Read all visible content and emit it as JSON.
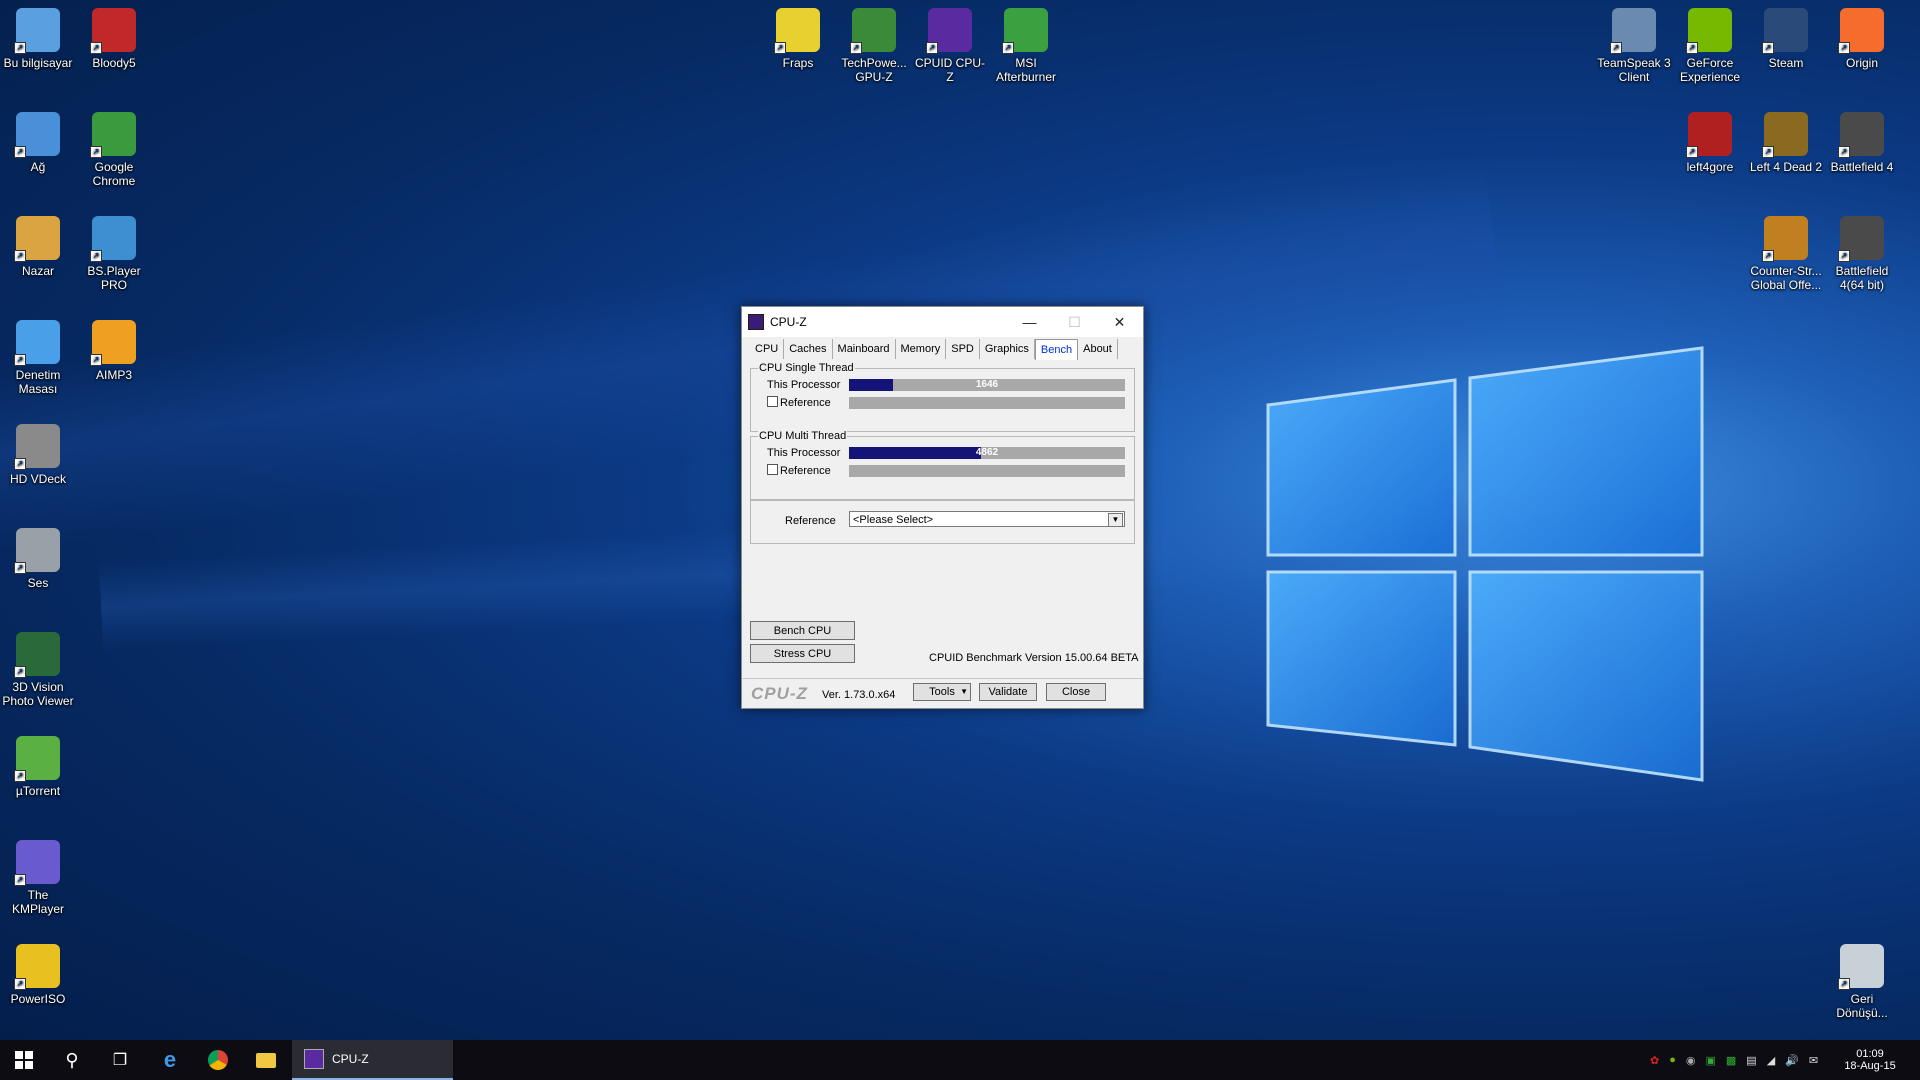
{
  "desktop": {
    "icons": [
      {
        "label": "Bu bilgisayar",
        "icon": "computer-icon",
        "color": "#5aa0e0"
      },
      {
        "label": "Bloody5",
        "icon": "bloody-icon",
        "color": "#c0282a"
      },
      {
        "label": "Ağ",
        "icon": "network-icon",
        "color": "#4a90d9"
      },
      {
        "label": "Google Chrome",
        "icon": "chrome-icon",
        "color": "#3a9a3e"
      },
      {
        "label": "Nazar",
        "icon": "user-folder-icon",
        "color": "#d9a441"
      },
      {
        "label": "BS.Player PRO",
        "icon": "bsplayer-icon",
        "color": "#3d8fd1"
      },
      {
        "label": "Denetim Masası",
        "icon": "control-panel-icon",
        "color": "#4aa0e8"
      },
      {
        "label": "AIMP3",
        "icon": "aimp-icon",
        "color": "#f0a020"
      },
      {
        "label": "HD VDeck",
        "icon": "hdvdeck-icon",
        "color": "#8a8a8a"
      },
      {
        "label": "Ses",
        "icon": "speaker-icon",
        "color": "#9aa0a8"
      },
      {
        "label": "3D Vision Photo Viewer",
        "icon": "3dvision-icon",
        "color": "#2a6a3a"
      },
      {
        "label": "µTorrent",
        "icon": "utorrent-icon",
        "color": "#5ab043"
      },
      {
        "label": "The KMPlayer",
        "icon": "kmplayer-icon",
        "color": "#6a5ad0"
      },
      {
        "label": "PowerISO",
        "icon": "poweriso-icon",
        "color": "#e8c020"
      },
      {
        "label": "Fraps",
        "icon": "fraps-icon",
        "color": "#e8d030"
      },
      {
        "label": "TechPowe... GPU-Z",
        "icon": "gpuz-icon",
        "color": "#3a8a3a"
      },
      {
        "label": "CPUID CPU-Z",
        "icon": "cpuz-icon",
        "color": "#5a2aa0"
      },
      {
        "label": "MSI Afterburner",
        "icon": "afterburner-icon",
        "color": "#3aa040"
      },
      {
        "label": "TeamSpeak 3 Client",
        "icon": "teamspeak-icon",
        "color": "#6a8ab0"
      },
      {
        "label": "GeForce Experience",
        "icon": "geforce-icon",
        "color": "#76b900"
      },
      {
        "label": "Steam",
        "icon": "steam-icon",
        "color": "#2a4a7a"
      },
      {
        "label": "Origin",
        "icon": "origin-icon",
        "color": "#f56c2d"
      },
      {
        "label": "left4gore",
        "icon": "left4gore-icon",
        "color": "#b02020"
      },
      {
        "label": "Left 4 Dead 2",
        "icon": "l4d2-icon",
        "color": "#8a6a20"
      },
      {
        "label": "Battlefield 4",
        "icon": "bf4-icon",
        "color": "#4a4a4a"
      },
      {
        "label": "Counter-Str... Global Offe...",
        "icon": "csgo-icon",
        "color": "#c08020"
      },
      {
        "label": "Battlefield 4(64 bit)",
        "icon": "bf4-64-icon",
        "color": "#4a4a4a"
      },
      {
        "label": "Geri Dönüşü...",
        "icon": "recycle-bin-icon",
        "color": "#c8d0d8"
      }
    ]
  },
  "window": {
    "title": "CPU-Z",
    "tabs": [
      "CPU",
      "Caches",
      "Mainboard",
      "Memory",
      "SPD",
      "Graphics",
      "Bench",
      "About"
    ],
    "active_tab": "Bench",
    "single": {
      "legend": "CPU Single Thread",
      "this_label": "This Processor",
      "this_value": "1646",
      "this_fraction": 0.16,
      "ref_label": "Reference"
    },
    "multi": {
      "legend": "CPU Multi Thread",
      "this_label": "This Processor",
      "this_value": "4862",
      "this_fraction": 0.48,
      "ref_label": "Reference"
    },
    "reference": {
      "label": "Reference",
      "selected": "<Please Select>"
    },
    "bench_button": "Bench CPU",
    "stress_button": "Stress CPU",
    "bench_version": "CPUID Benchmark Version 15.00.64 BETA",
    "logo": "CPU-Z",
    "version": "Ver. 1.73.0.x64",
    "tools_button": "Tools",
    "validate_button": "Validate",
    "close_button": "Close"
  },
  "taskbar": {
    "active_app": "CPU-Z",
    "time": "01:09",
    "date": "18-Aug-15"
  }
}
